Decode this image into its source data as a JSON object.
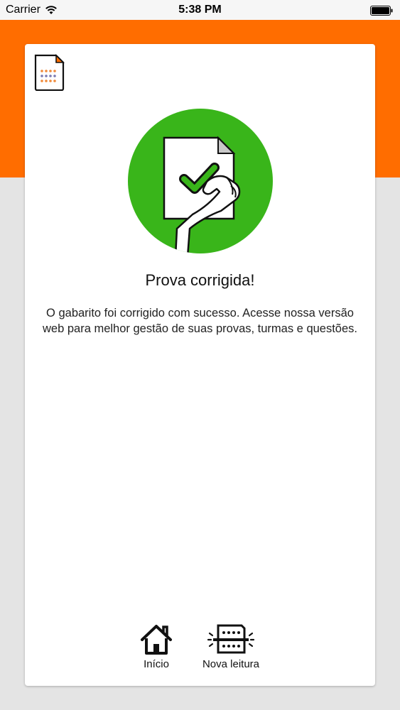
{
  "status_bar": {
    "carrier": "Carrier",
    "time": "5:38 PM"
  },
  "card": {
    "title": "Prova corrigida!",
    "message": "O gabarito foi corrigido com sucesso. Acesse nossa versão web para melhor gestão de suas provas, turmas e questões.",
    "actions": [
      {
        "label": "Início",
        "icon": "home-icon"
      },
      {
        "label": "Nova leitura",
        "icon": "scan-sheet-icon"
      }
    ]
  },
  "colors": {
    "accent": "#ff6d00",
    "success": "#39b51a",
    "background": "#e4e4e4"
  }
}
